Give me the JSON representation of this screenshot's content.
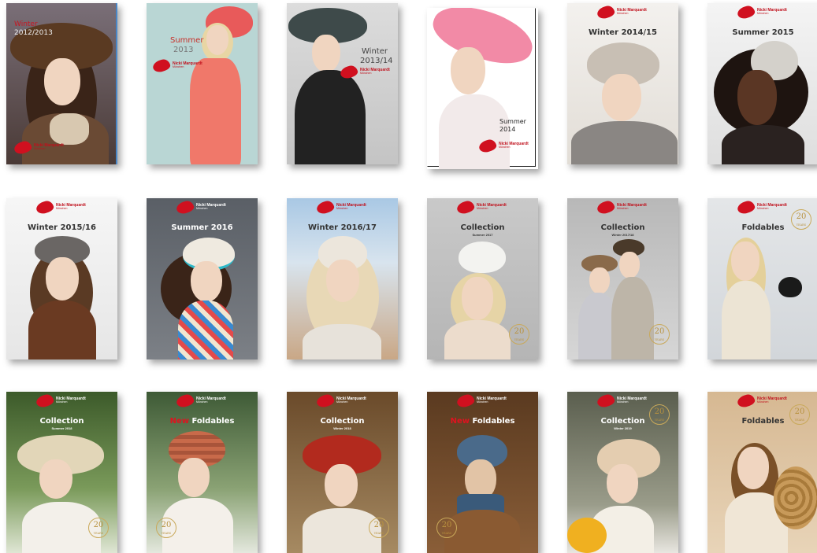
{
  "brand": {
    "name": "Nicki Marquardt",
    "city": "München"
  },
  "badge": {
    "number": "20",
    "word": "YEARS"
  },
  "covers": [
    {
      "id": "c1",
      "title": "Winter",
      "subtitle": "2012/2013"
    },
    {
      "id": "c2",
      "title": "Summer",
      "subtitle": "2013"
    },
    {
      "id": "c3",
      "title": "Winter",
      "subtitle": "2013/14"
    },
    {
      "id": "c4",
      "title": "Summer",
      "subtitle": "2014"
    },
    {
      "id": "c5",
      "title": "Winter 2014/15",
      "subtitle": ""
    },
    {
      "id": "c6",
      "title": "Summer 2015",
      "subtitle": ""
    },
    {
      "id": "c7",
      "title": "Winter 2015/16",
      "subtitle": ""
    },
    {
      "id": "c8",
      "title": "Summer 2016",
      "subtitle": ""
    },
    {
      "id": "c9",
      "title": "Winter 2016/17",
      "subtitle": ""
    },
    {
      "id": "c10",
      "title": "Collection",
      "subtitle": "Summer 2017"
    },
    {
      "id": "c11",
      "title": "Collection",
      "subtitle": "Winter 2017/18"
    },
    {
      "id": "c12",
      "title": "Foldables",
      "subtitle": ""
    },
    {
      "id": "c13",
      "title": "Collection",
      "subtitle": "Summer 2018"
    },
    {
      "id": "c14",
      "title": "Foldables",
      "subtitle": "",
      "new": "New"
    },
    {
      "id": "c15",
      "title": "Collection",
      "subtitle": "Winter 2018"
    },
    {
      "id": "c16",
      "title": "Foldables",
      "subtitle": "",
      "new": "New"
    },
    {
      "id": "c17",
      "title": "Collection",
      "subtitle": "Winter 2019"
    },
    {
      "id": "c18",
      "title": "Foldables",
      "subtitle": ""
    }
  ],
  "colors": {
    "brand_red": "#d0101f",
    "gold": "#b8923f"
  }
}
